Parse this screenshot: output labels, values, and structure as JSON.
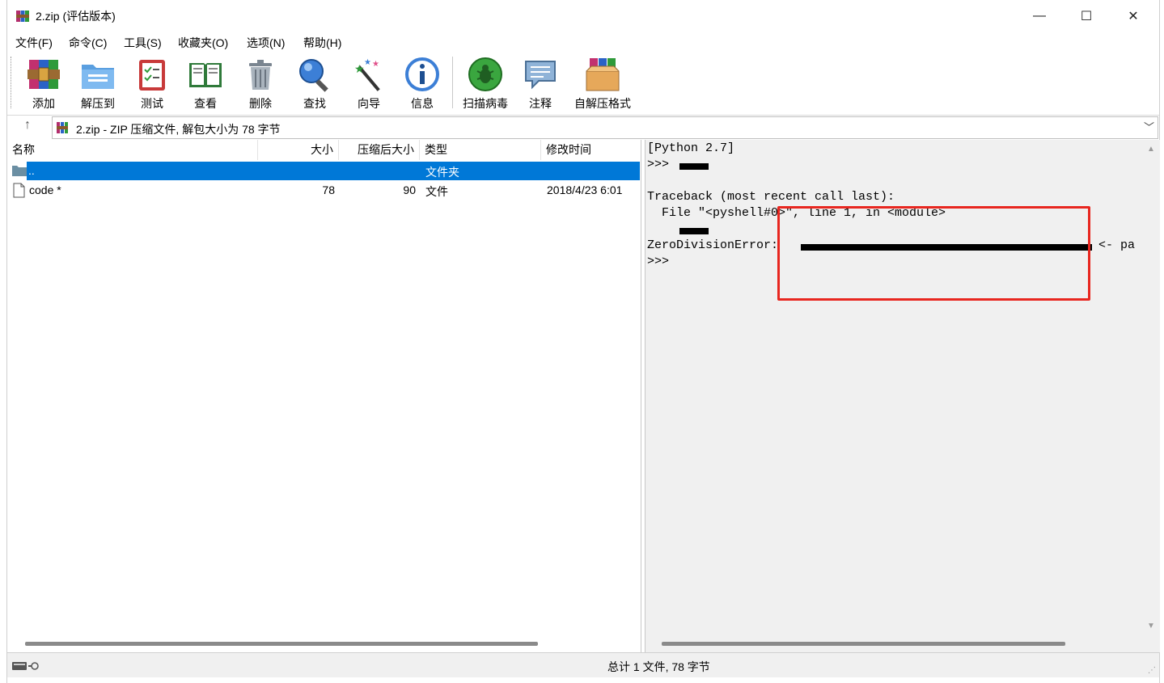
{
  "window": {
    "title": "2.zip (评估版本)",
    "controls": {
      "minimize": "—",
      "maximize": "☐",
      "close": "✕"
    }
  },
  "menu": [
    {
      "label": "文件(F)"
    },
    {
      "label": "命令(C)"
    },
    {
      "label": "工具(S)"
    },
    {
      "label": "收藏夹(O)"
    },
    {
      "label": "选项(N)"
    },
    {
      "label": "帮助(H)"
    }
  ],
  "toolbar": [
    {
      "label": "添加",
      "icon": "add-archive-icon"
    },
    {
      "label": "解压到",
      "icon": "extract-to-icon"
    },
    {
      "label": "测试",
      "icon": "test-icon"
    },
    {
      "label": "查看",
      "icon": "view-icon"
    },
    {
      "label": "删除",
      "icon": "delete-icon"
    },
    {
      "label": "查找",
      "icon": "find-icon"
    },
    {
      "label": "向导",
      "icon": "wizard-icon"
    },
    {
      "label": "信息",
      "icon": "info-icon"
    },
    {
      "label": "扫描病毒",
      "icon": "scan-virus-icon"
    },
    {
      "label": "注释",
      "icon": "comment-icon"
    },
    {
      "label": "自解压格式",
      "icon": "sfx-icon"
    }
  ],
  "address": {
    "text": "2.zip - ZIP 压缩文件, 解包大小为 78 字节"
  },
  "columns": {
    "name": "名称",
    "size": "大小",
    "packed": "压缩后大小",
    "type": "类型",
    "modified": "修改时间"
  },
  "files": [
    {
      "name": "..",
      "size": "",
      "packed": "",
      "type": "文件夹",
      "modified": "",
      "selected": true
    },
    {
      "name": "code *",
      "size": "78",
      "packed": "90",
      "type": "文件",
      "modified": "2018/4/23 6:01",
      "selected": false
    }
  ],
  "comment_lines": [
    "[Python 2.7]",
    ">>> ",
    "",
    "Traceback (most recent call last):",
    "  File \"<pyshell#0>\", line 1, in <module>",
    "",
    "ZeroDivisionError: ",
    ">>>"
  ],
  "comment_suffix": "<- pa",
  "status": {
    "text": "总计 1 文件, 78 字节"
  },
  "colors": {
    "selection": "#0078d7",
    "highlight_box": "#e8261f",
    "pane_bg": "#f0f0f0"
  }
}
